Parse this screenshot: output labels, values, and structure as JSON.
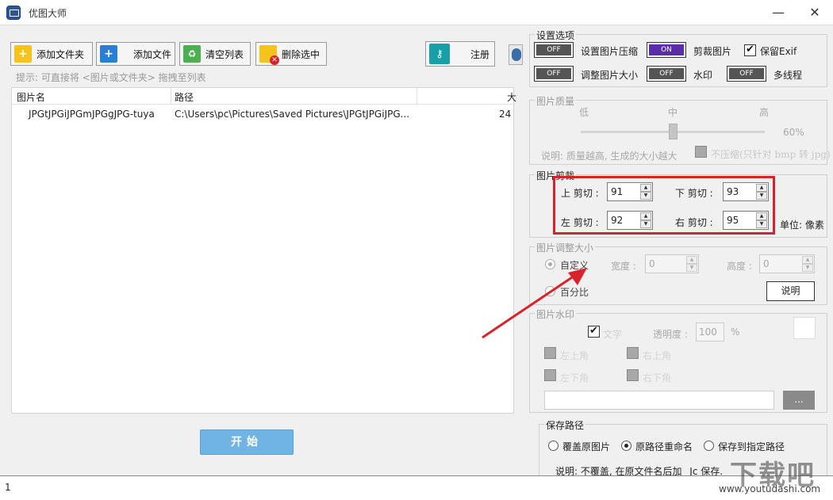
{
  "window": {
    "title": "优图大师",
    "min": "—",
    "close": "✕"
  },
  "toolbar": {
    "add_folder": "添加文件夹",
    "add_file": "添加文件",
    "clear_list": "清空列表",
    "delete_selected": "删除选中",
    "register": "注册"
  },
  "hint": "提示: 可直接将 <图片或文件夹> 拖拽至列表",
  "table": {
    "columns": [
      "图片名",
      "路径",
      "大"
    ],
    "rows": [
      {
        "name": "JPGtJPGiJPGmJPGgJPG-tuya",
        "path": "C:\\Users\\pc\\Pictures\\Saved Pictures\\JPGtJPGiJPG...",
        "size": "24"
      }
    ]
  },
  "start_label": "开始",
  "status": "1",
  "settings": {
    "title": "设置选项",
    "compress": {
      "label": "设置图片压缩",
      "state": "OFF"
    },
    "crop": {
      "label": "剪裁图片",
      "state": "ON"
    },
    "exif": {
      "label": "保留Exif",
      "checked": true
    },
    "resize": {
      "label": "调整图片大小",
      "state": "OFF"
    },
    "watermark": {
      "label": "水印",
      "state": "OFF"
    },
    "multithread": {
      "label": "多线程",
      "state": "OFF"
    }
  },
  "quality": {
    "title": "图片质量",
    "low": "低",
    "mid": "中",
    "high": "高",
    "value": "60%",
    "note": "说明: 质量越高, 生成的大小越大",
    "checkbox_label": "不压缩(只针对 bmp 转 jpg)"
  },
  "crop": {
    "title": "图片剪裁",
    "top_label": "上 剪切 :",
    "top_value": "91",
    "bottom_label": "下 剪切 :",
    "bottom_value": "93",
    "left_label": "左 剪切 :",
    "left_value": "92",
    "right_label": "右 剪切 :",
    "right_value": "95",
    "unit": "单位: 像素"
  },
  "resize": {
    "title": "图片调整大小",
    "custom": "自定义",
    "width_label": "宽度 :",
    "width_value": "0",
    "height_label": "高度 :",
    "height_value": "0",
    "percent": "百分比",
    "explain": "说明"
  },
  "wm": {
    "title": "图片水印",
    "text": "文字",
    "opacity_label": "透明度 :",
    "opacity_value": "100",
    "opacity_unit": "%",
    "top_left": "左上角",
    "top_right": "右上角",
    "bottom_left": "左下角",
    "bottom_right": "右下角",
    "browse": "..."
  },
  "save": {
    "title": "保存路径",
    "overwrite": "覆盖原图片",
    "rename": "原路径重命名",
    "custom": "保存到指定路径",
    "note": "说明: 不覆盖, 在原文件名后加 _Jc 保存."
  },
  "site_watermark": "www.youtudashi.com",
  "site_mark": "下载吧",
  "colors": {
    "crop_highlight": "#d8232a",
    "start_button": "#6fb4e4",
    "toggle_on": "#5a2ea8",
    "arrow": "#d8232a"
  }
}
